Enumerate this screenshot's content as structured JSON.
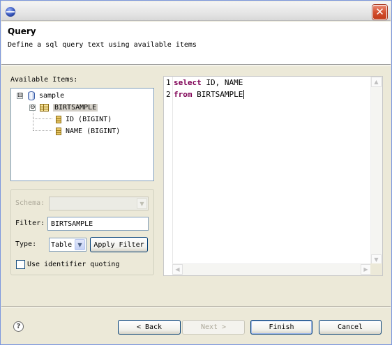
{
  "window": {
    "close_glyph": "✕"
  },
  "header": {
    "title": "Query",
    "description": "Define a sql query text using available items"
  },
  "available_items": {
    "label": "Available Items:",
    "tree": [
      {
        "label": "sample",
        "type": "database",
        "expander": "⊟"
      },
      {
        "label": "BIRTSAMPLE",
        "type": "table",
        "expander": "⊖",
        "selected": true
      },
      {
        "label": "ID (BIGINT)",
        "type": "column"
      },
      {
        "label": "NAME (BIGINT)",
        "type": "column"
      }
    ]
  },
  "filter_panel": {
    "schema_label": "Schema:",
    "schema_value": "",
    "filter_label": "Filter:",
    "filter_value": "BIRTSAMPLE",
    "type_label": "Type:",
    "type_value": "Table",
    "apply_button": "Apply Filter",
    "identifier_quoting_label": "Use identifier quoting",
    "identifier_quoting_checked": false
  },
  "editor": {
    "line_numbers": [
      "1",
      "2"
    ],
    "lines": [
      {
        "keyword": "select",
        "rest": " ID, NAME"
      },
      {
        "keyword": "from",
        "rest": " BIRTSAMPLE"
      }
    ]
  },
  "footer": {
    "help_glyph": "?",
    "back_button": "< Back",
    "next_button": "Next >",
    "finish_button": "Finish",
    "cancel_button": "Cancel"
  },
  "colors": {
    "keyword": "#7f0055",
    "dialog_bg": "#ece9d8",
    "button_border": "#003c74"
  }
}
